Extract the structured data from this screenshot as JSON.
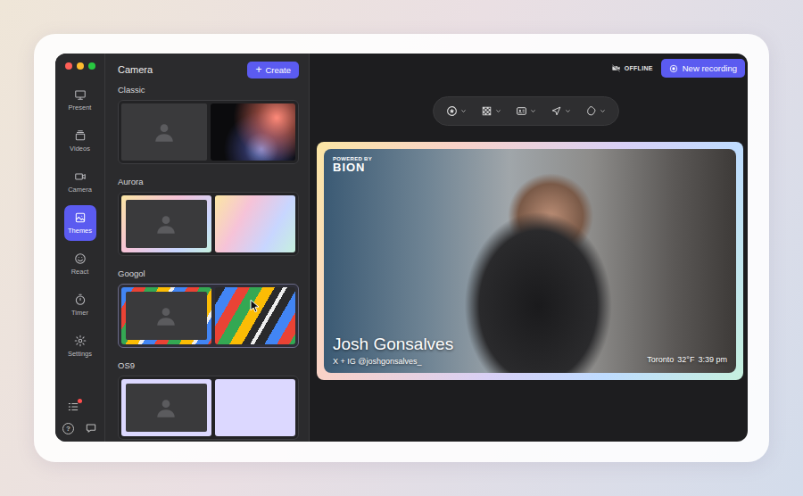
{
  "sidebar": {
    "items": [
      {
        "label": "Present",
        "selected": false
      },
      {
        "label": "Videos",
        "selected": false
      },
      {
        "label": "Camera",
        "selected": false
      },
      {
        "label": "Themes",
        "selected": true
      },
      {
        "label": "React",
        "selected": false
      },
      {
        "label": "Timer",
        "selected": false
      },
      {
        "label": "Settings",
        "selected": false
      }
    ],
    "help_icon": "?"
  },
  "panel": {
    "title": "Camera",
    "create_icon": "+",
    "create_button": "Create",
    "themes": [
      {
        "name": "Classic",
        "kind": "classic",
        "selected": false
      },
      {
        "name": "Aurora",
        "kind": "aurora",
        "selected": false
      },
      {
        "name": "Googol",
        "kind": "googol",
        "selected": true
      },
      {
        "name": "OS9",
        "kind": "os9",
        "selected": false
      }
    ]
  },
  "status": {
    "label": "OFFLINE"
  },
  "record_button": {
    "label": "New recording"
  },
  "preview": {
    "badge_top": "POWERED BY",
    "badge_logo": "BION",
    "name": "Josh Gonsalves",
    "handle": "X + IG @joshgonsalves_",
    "location": "Toronto",
    "temperature": "32°F",
    "time": "3:39 pm"
  }
}
